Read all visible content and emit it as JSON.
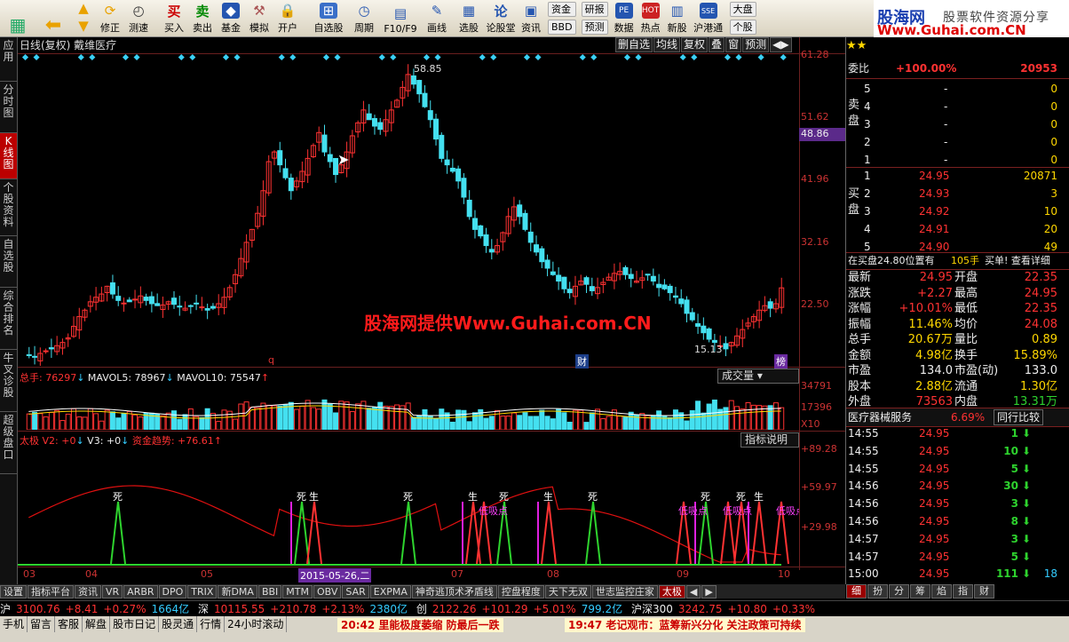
{
  "toolbar": {
    "items": [
      "修正",
      "测速",
      "买入",
      "卖出",
      "基金",
      "模拟",
      "开户",
      "自选股",
      "周期",
      "F10/F9",
      "画线",
      "选股",
      "论股堂",
      "资讯",
      "数据",
      "热点",
      "新股",
      "沪港通"
    ],
    "small_buttons": [
      "资金",
      "研报",
      "BBD",
      "预测",
      "大盘",
      "个股"
    ]
  },
  "brand": {
    "name": "股海网",
    "tagline": "股票软件资源分享",
    "url": "Www.Guhai.com.CN"
  },
  "left_tabs": [
    "应用",
    "分时图",
    "K线图",
    "个股资料",
    "自选股",
    "综合排名",
    "牛叉诊股",
    "超级盘口"
  ],
  "chart": {
    "title": "日线(复权) 戴维医疗",
    "tools": [
      "删自选",
      "均线",
      "复权",
      "叠",
      "窗",
      "预测",
      "◀▶"
    ],
    "price_labels": [
      "61.28",
      "51.62",
      "41.96",
      "32.16",
      "22.50"
    ],
    "current_price": "48.86",
    "high_mark": "58.85",
    "low_mark": "15.13",
    "marker_q": "q",
    "marker_cai": "财",
    "marker_bang": "榜",
    "watermark": "股海网提供Www.Guhai.com.CN",
    "colors": {
      "up": "#ff3232",
      "down": "#44e0f0",
      "grid": "#6a1f1f"
    }
  },
  "volume": {
    "total_label": "总手: 76297",
    "mavol5": "MAVOL5: 78967",
    "mavol10": "MAVOL10: 75547",
    "button": "成交量",
    "labels": [
      "34791",
      "17396",
      "X10"
    ]
  },
  "indicator": {
    "name": "太极",
    "v2": "V2: +0",
    "v3": "V3: +0",
    "zijin": "资金趋势: +76.61",
    "button": "指标说明",
    "labels": [
      "+89.28",
      "+59.97",
      "+29.98"
    ],
    "signals": [
      "死",
      "死",
      "生",
      "死",
      "生",
      "低吸点",
      "死",
      "生",
      "死",
      "低吸点",
      "死",
      "低吸点",
      "死",
      "生",
      "低吸点"
    ],
    "date_labels": [
      "03",
      "04",
      "05",
      "2015-05-26,二",
      "07",
      "08",
      "09",
      "10"
    ]
  },
  "bottom_tabs": [
    "设置",
    "指标平台",
    "资讯",
    "VR",
    "ARBR",
    "DPO",
    "TRIX",
    "新DMA",
    "BBI",
    "MTM",
    "OBV",
    "SAR",
    "EXPMA",
    "神奇逃顶术矛盾线",
    "控盘程度",
    "天下无双",
    "世志监控庄家",
    "太极"
  ],
  "ticker": {
    "sh_label": "沪",
    "sh": "3100.76",
    "sh_chg": "+8.41",
    "sh_pct": "+0.27%",
    "sh_amt": "1664亿",
    "sz_label": "深",
    "sz": "10115.55",
    "sz_chg": "+210.78",
    "sz_pct": "+2.13%",
    "sz_amt": "2380亿",
    "cy_label": "创",
    "cy": "2122.26",
    "cy_chg": "+101.29",
    "cy_pct": "+5.01%",
    "cy_amt": "799.2亿",
    "hs_label": "沪深300",
    "hs": "3242.75",
    "hs_chg": "+10.80",
    "hs_pct": "+0.33%"
  },
  "status": {
    "tabs": [
      "手机",
      "留言",
      "客服",
      "解盘",
      "股市日记",
      "股灵通",
      "行情",
      "24小时滚动"
    ],
    "news1": "20:42 里能极度萎缩 防最后一跌",
    "news2": "19:47 老记观市：蓝筹新兴分化 关注政策可持续"
  },
  "right": {
    "weibi_label": "委比",
    "weibi": "+100.00%",
    "weicha": "20953",
    "sell_label": "卖盘",
    "buy_label": "买盘",
    "sell": [
      {
        "n": "5",
        "p": "-",
        "v": "0"
      },
      {
        "n": "4",
        "p": "-",
        "v": "0"
      },
      {
        "n": "3",
        "p": "-",
        "v": "0"
      },
      {
        "n": "2",
        "p": "-",
        "v": "0"
      },
      {
        "n": "1",
        "p": "-",
        "v": "0"
      }
    ],
    "buy": [
      {
        "n": "1",
        "p": "24.95",
        "v": "20871"
      },
      {
        "n": "2",
        "p": "24.93",
        "v": "3"
      },
      {
        "n": "3",
        "p": "24.92",
        "v": "10"
      },
      {
        "n": "4",
        "p": "24.91",
        "v": "20"
      },
      {
        "n": "5",
        "p": "24.90",
        "v": "49"
      }
    ],
    "notice": "在买盘24.80位置有",
    "notice_vol": "105手",
    "notice_act": "买单! 查看详细",
    "quote": [
      [
        "最新",
        "24.95",
        "开盘",
        "22.35"
      ],
      [
        "涨跌",
        "+2.27",
        "最高",
        "24.95"
      ],
      [
        "涨幅",
        "+10.01%",
        "最低",
        "22.35"
      ],
      [
        "振幅",
        "11.46%",
        "均价",
        "24.08"
      ],
      [
        "总手",
        "20.67万",
        "量比",
        "0.89"
      ],
      [
        "金额",
        "4.98亿",
        "换手",
        "15.89%"
      ],
      [
        "市盈",
        "134.0",
        "市盈(动)",
        "133.0"
      ],
      [
        "股本",
        "2.88亿",
        "流通",
        "1.30亿"
      ],
      [
        "外盘",
        "73563",
        "内盘",
        "13.31万"
      ]
    ],
    "sector": "医疗器械服务",
    "sector_pct": "6.69%",
    "sector_btn": "同行比较",
    "ticks": [
      [
        "14:55",
        "24.95",
        "1"
      ],
      [
        "14:55",
        "24.95",
        "10"
      ],
      [
        "14:55",
        "24.95",
        "5"
      ],
      [
        "14:56",
        "24.95",
        "30"
      ],
      [
        "14:56",
        "24.95",
        "3"
      ],
      [
        "14:56",
        "24.95",
        "8"
      ],
      [
        "14:57",
        "24.95",
        "3"
      ],
      [
        "14:57",
        "24.95",
        "5"
      ],
      [
        "15:00",
        "24.95",
        "111"
      ]
    ],
    "last_tick_extra": "18",
    "tabs": [
      "细",
      "扮",
      "分",
      "筹",
      "焰",
      "指",
      "财"
    ]
  }
}
